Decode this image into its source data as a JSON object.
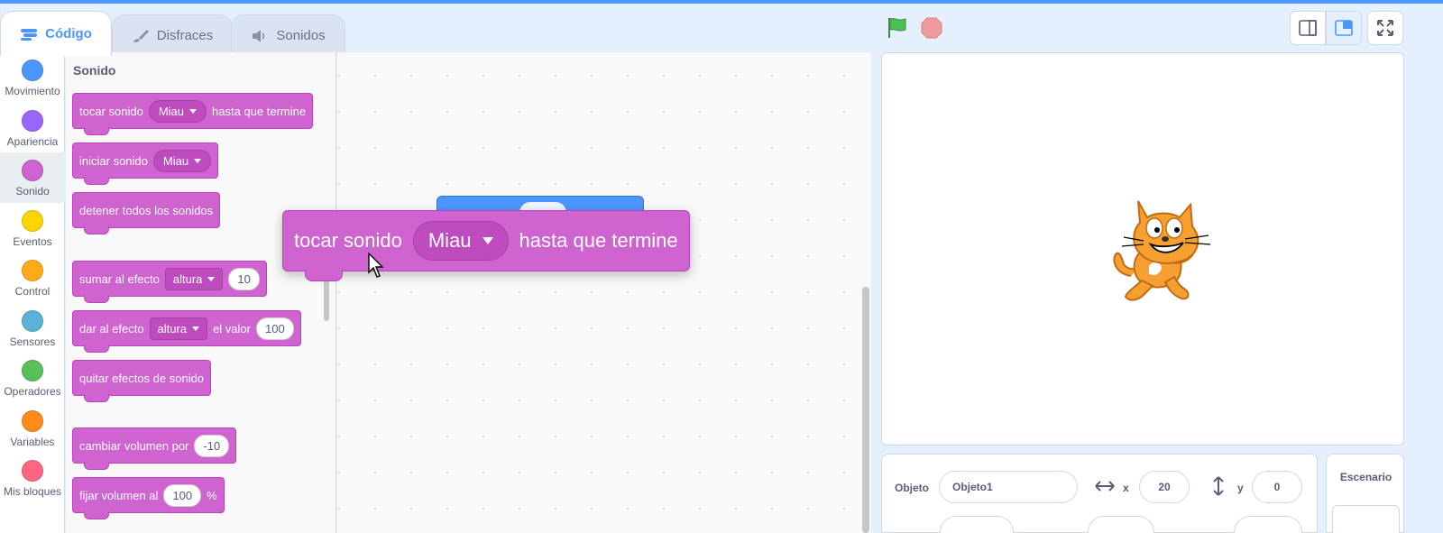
{
  "tabs": [
    {
      "label": "Código",
      "icon": "code-icon",
      "active": true
    },
    {
      "label": "Disfraces",
      "icon": "brush-icon",
      "active": false
    },
    {
      "label": "Sonidos",
      "icon": "speaker-icon",
      "active": false
    }
  ],
  "categories": [
    {
      "label": "Movimiento",
      "color": "#4c97ff"
    },
    {
      "label": "Apariencia",
      "color": "#9966ff"
    },
    {
      "label": "Sonido",
      "color": "#cf63cf",
      "selected": true
    },
    {
      "label": "Eventos",
      "color": "#ffd500"
    },
    {
      "label": "Control",
      "color": "#ffab19"
    },
    {
      "label": "Sensores",
      "color": "#5cb1d6"
    },
    {
      "label": "Operadores",
      "color": "#59c059"
    },
    {
      "label": "Variables",
      "color": "#ff8c1a"
    },
    {
      "label": "Mis bloques",
      "color": "#ff6680"
    }
  ],
  "palette": {
    "title": "Sonido",
    "blocks": {
      "play_until_done": {
        "text1": "tocar sonido",
        "sound": "Miau",
        "text2": "hasta que termine"
      },
      "start_sound": {
        "text1": "iniciar sonido",
        "sound": "Miau"
      },
      "stop_all": {
        "text1": "detener todos los sonidos"
      },
      "change_effect": {
        "text1": "sumar al efecto",
        "effect": "altura",
        "value": "10"
      },
      "set_effect": {
        "text1": "dar al efecto",
        "effect": "altura",
        "text2": "el valor",
        "value": "100"
      },
      "clear_effects": {
        "text1": "quitar efectos de sonido"
      },
      "change_volume": {
        "text1": "cambiar volumen por",
        "value": "-10"
      },
      "set_volume": {
        "text1": "fijar volumen al",
        "value": "100",
        "suffix": "%"
      }
    }
  },
  "dragging_block": {
    "text1": "tocar sonido",
    "sound": "Miau",
    "text2": "hasta que termine"
  },
  "stage_header": {
    "flag_icon": "green-flag-icon",
    "stop_icon": "stop-icon",
    "view_buttons": [
      "small-stage-icon",
      "normal-stage-icon",
      "fullscreen-icon"
    ]
  },
  "sprite_info": {
    "sprite_label": "Objeto",
    "sprite_name": "Objeto1",
    "x_label": "x",
    "x_value": "20",
    "y_label": "y",
    "y_value": "0"
  },
  "stage_panel": {
    "title": "Escenario"
  },
  "colors": {
    "accent": "#4c97ff",
    "sound": "#cf63cf",
    "sound_dark": "#bd42bd"
  }
}
